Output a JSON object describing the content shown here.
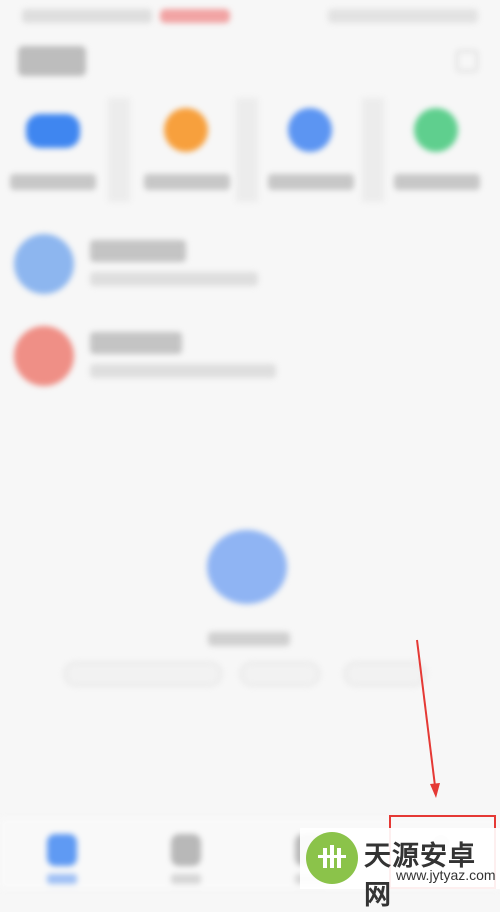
{
  "watermark": {
    "title": "天源安卓网",
    "url": "www.jytyaz.com"
  },
  "colors": {
    "shortcut_1": "#3f86f0",
    "shortcut_2": "#f7a03d",
    "shortcut_3": "#5c95f2",
    "shortcut_4": "#5fcf8e",
    "contact_1": "#8db6ef",
    "contact_2": "#ef8f86",
    "empty_art": "#8fb4f3",
    "tab_active": "#5f9af3",
    "tab_inactive": "#b8b8b8",
    "annotation": "#e53935"
  },
  "icons": {
    "shortcuts": [
      "video-call-icon",
      "contacts-icon",
      "chat-icon",
      "phone-icon"
    ],
    "tabs": [
      "messages-tab-icon",
      "contacts-tab-icon",
      "calls-tab-icon",
      "me-tab-icon"
    ],
    "empty": "message-bubble-illustration",
    "watermark": "android-logo"
  }
}
